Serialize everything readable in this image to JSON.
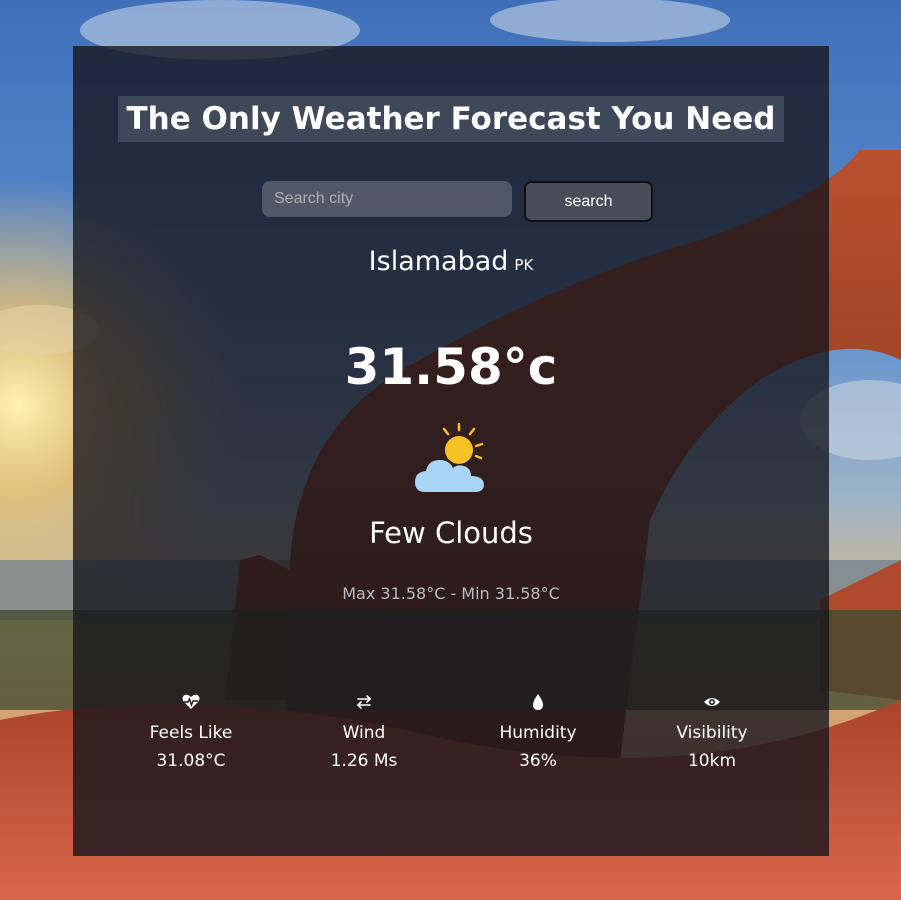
{
  "header": {
    "title": "The Only Weather Forecast You Need"
  },
  "search": {
    "placeholder": "Search city",
    "value": "",
    "button_label": "search"
  },
  "location": {
    "city": "Islamabad",
    "country": "PK"
  },
  "current": {
    "temperature": "31.58°c",
    "condition": "Few Clouds",
    "condition_icon": "sun-behind-cloud-icon",
    "min_max": "Max 31.58°C - Min 31.58°C"
  },
  "stats": [
    {
      "icon": "heartbeat-icon",
      "label": "Feels Like",
      "value": "31.08°C"
    },
    {
      "icon": "arrows-exchange-icon",
      "label": "Wind",
      "value": "1.26 Ms"
    },
    {
      "icon": "droplet-icon",
      "label": "Humidity",
      "value": "36%"
    },
    {
      "icon": "eye-icon",
      "label": "Visibility",
      "value": "10km"
    }
  ],
  "colors": {
    "panel": "#14141c",
    "sun": "#f6c325",
    "cloud": "#a8d4f5",
    "muted_text": "#b9bcc4"
  }
}
